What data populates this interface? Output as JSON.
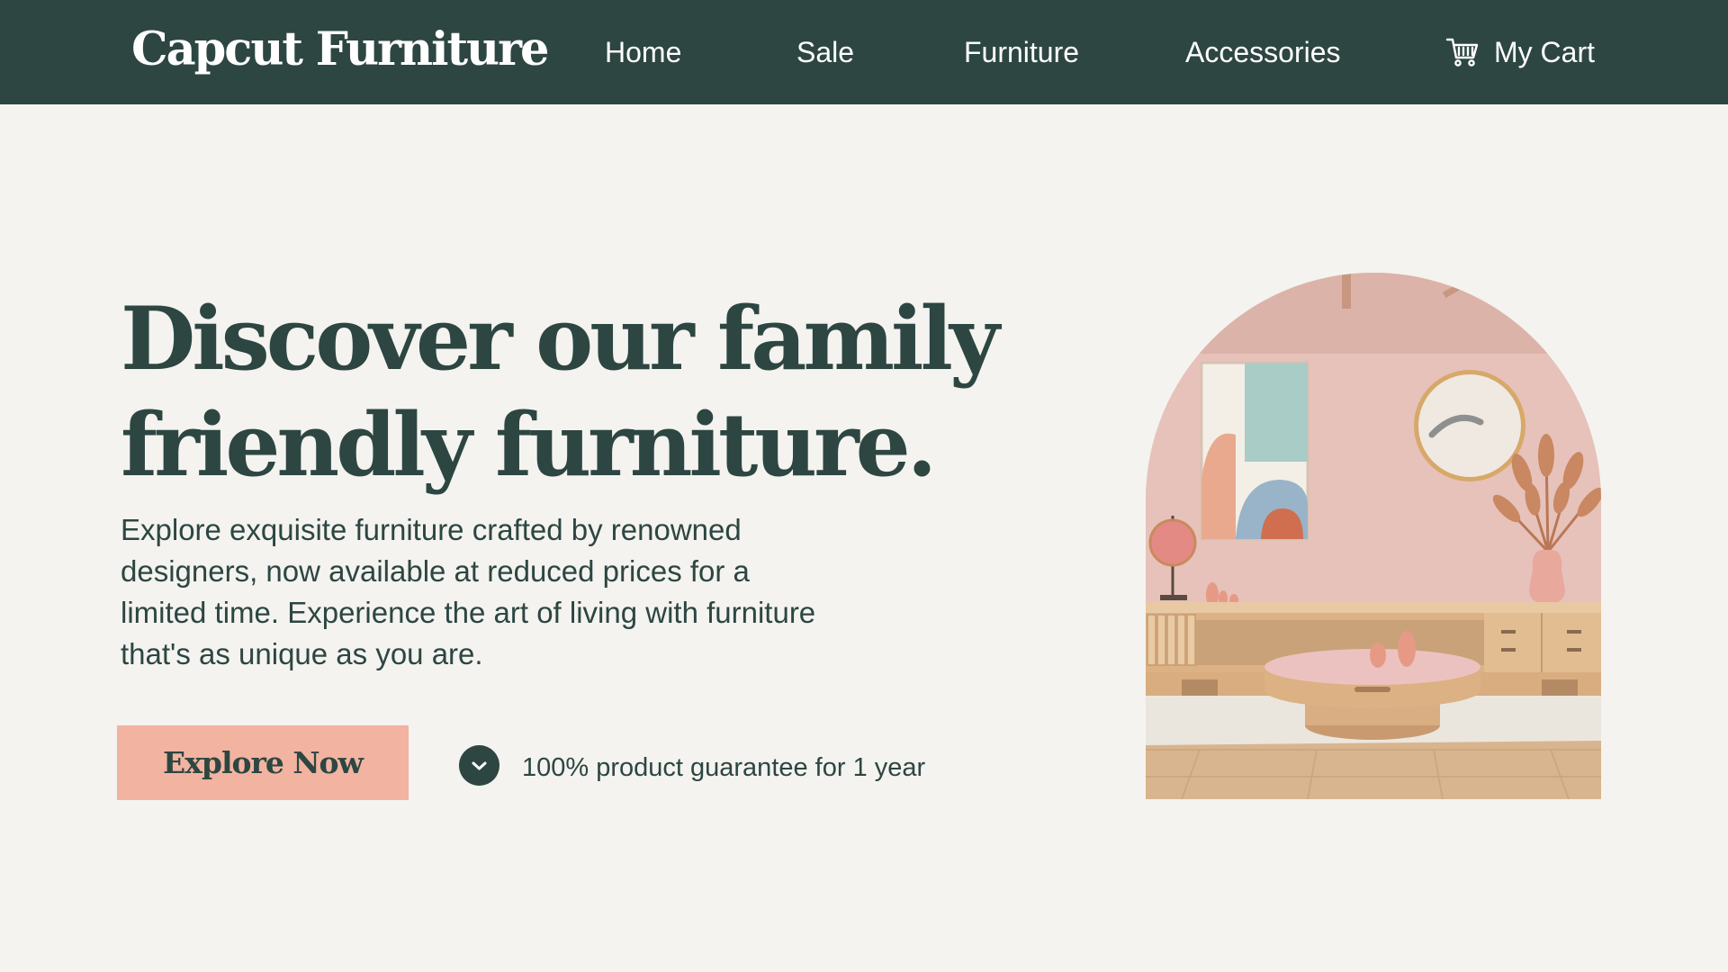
{
  "header": {
    "logo": "Capcut Furniture",
    "nav": [
      "Home",
      "Sale",
      "Furniture",
      "Accessories"
    ],
    "cart_label": "My Cart",
    "cart_icon": "cart-icon"
  },
  "hero": {
    "headline": "Discover our family friendly furniture.",
    "description": "Explore exquisite furniture crafted by renowned designers, now available at reduced prices for a limited time. Experience the art of living with furniture that's as unique as you are.",
    "cta_label": "Explore Now",
    "guarantee_icon": "chevron-down-icon",
    "guarantee_text": "100% product guarantee for 1 year",
    "image_subject": "pink living room with low wooden sideboard, round coffee table, abstract wall art, round mirror and pampas grass vase"
  },
  "colors": {
    "primary": "#2d4642",
    "accent": "#f2b3a0",
    "background": "#f4f3ef",
    "text_on_primary": "#ffffff"
  }
}
